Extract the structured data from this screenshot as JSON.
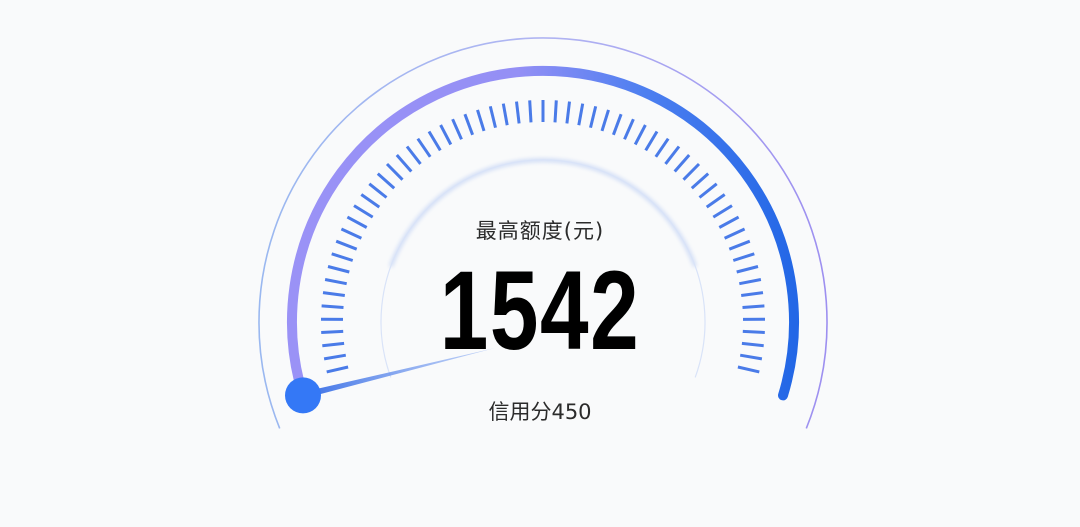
{
  "gauge": {
    "title": "最高额度(元)",
    "amount": "1542",
    "score_label": "信用分",
    "score_value": "450",
    "progress": 0,
    "colors": {
      "background": "#f9fafb",
      "accent_blue": "#2f6fe8",
      "accent_purple": "#9a92f6",
      "tick": "#4a7be8",
      "knob": "#3478f6",
      "text": "#2b2b2b",
      "value_text": "#000000"
    }
  }
}
